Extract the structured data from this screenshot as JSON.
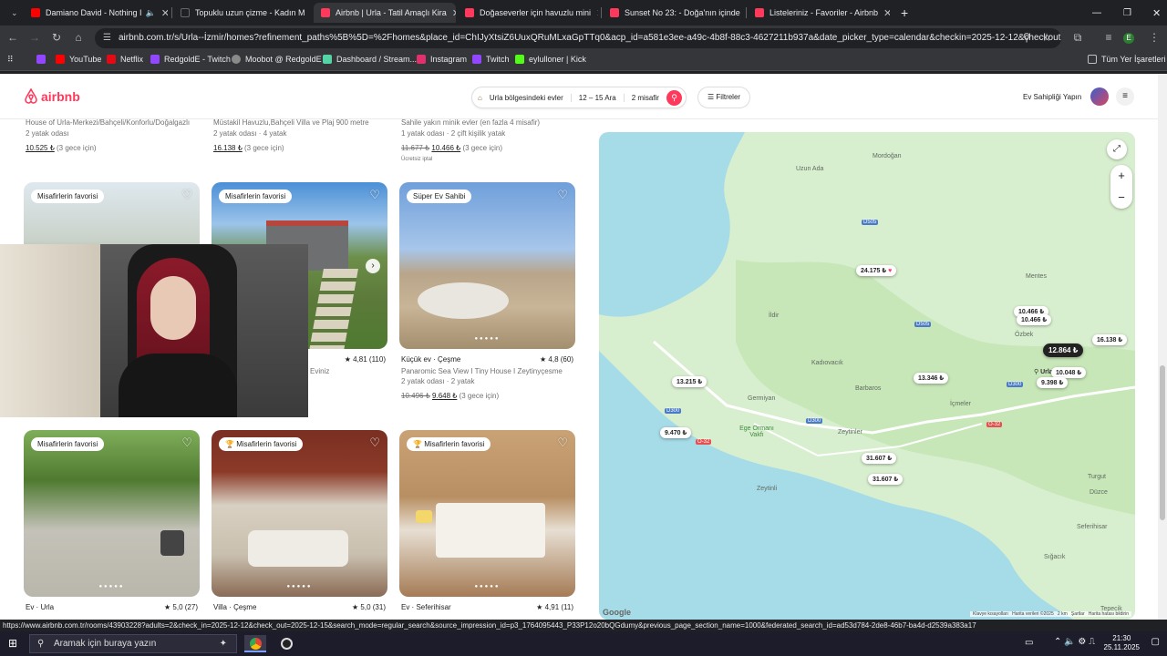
{
  "browser": {
    "tabs": [
      {
        "label": "Damiano David - Nothing I",
        "color": "#ff0000"
      },
      {
        "label": "Topuklu uzun çizme - Kadın M",
        "color": "#202124"
      },
      {
        "label": "Airbnb | Urla - Tatil Amaçlı Kira",
        "color": "#ff385c"
      },
      {
        "label": "Doğaseverler için havuzlu mini",
        "color": "#ff385c"
      },
      {
        "label": "Sunset No 23: - Doğa'nın içinde",
        "color": "#ff385c"
      },
      {
        "label": "Listeleriniz - Favoriler - Airbnb",
        "color": "#ff385c"
      }
    ],
    "url": "airbnb.com.tr/s/Urla--İzmir/homes?refinement_paths%5B%5D=%2Fhomes&place_id=ChIJyXtsiZ6UuxQRuMLxaGpTTq0&acp_id=a581e3ee-a49c-4b8f-88c3-4627211b937a&date_picker_type=calendar&checkin=2025-12-12&checkout=202...",
    "bookmarks": [
      "YouTube",
      "Netflix",
      "RedgoldE - Twitch",
      "Moobot @ RedgoldE",
      "Dashboard / Stream...",
      "Instagram",
      "Twitch",
      "eylulloner | Kick"
    ],
    "all_bookmarks": "Tüm Yer İşaretleri"
  },
  "header": {
    "logo": "airbnb",
    "location": "Urla bölgesindeki evler",
    "dates": "12 – 15 Ara",
    "guests": "2 misafir",
    "filters": "Filtreler",
    "host": "Ev Sahipliği Yapın"
  },
  "top_row": [
    {
      "title": "House of Urla-Merkezi/Bahçeli/Konforlu/Doğalgazlı",
      "sub": "2 yatak odası",
      "price": "10.525 ₺",
      "nights": "(3 gece için)",
      "old": ""
    },
    {
      "title": "Müstakil Havuzlu,Bahçeli Villa ve Plaj 900 metre",
      "sub": "2 yatak odası · 4 yatak",
      "price": "16.138 ₺",
      "nights": "(3 gece için)",
      "old": ""
    },
    {
      "title": "Sahile yakın minik evler (en fazla 4 misafir)",
      "sub": "1 yatak odası · 2 çift kişilik yatak",
      "price": "10.466 ₺",
      "nights": "(3 gece için)",
      "old": "11.677 ₺",
      "extra": "Ücretsiz iptal"
    }
  ],
  "cards": [
    {
      "badge": "Misafirlerin favorisi",
      "title": "",
      "rating": "",
      "sub1": "",
      "sub2": "",
      "price": "",
      "old": ""
    },
    {
      "badge": "Misafirlerin favorisi",
      "title": "",
      "rating": "★ 4,81 (110)",
      "sub1": "Eviniz",
      "sub2": "",
      "price": "",
      "old": ""
    },
    {
      "badge": "Süper Ev Sahibi",
      "title": "Küçük ev · Çeşme",
      "rating": "★ 4,8 (60)",
      "sub1": "Panaromic Sea View I Tiny House I Zeytinyçesme",
      "sub2": "2 yatak odası · 2 yatak",
      "price": "9.648 ₺",
      "old": "10.496 ₺",
      "nights": "(3 gece için)"
    },
    {
      "badge": "Misafirlerin favorisi",
      "title": "Ev · Urla",
      "rating": "★ 5,0 (27)",
      "sub1": "",
      "sub2": "",
      "price": "",
      "old": ""
    },
    {
      "badge": "Misafirlerin favorisi",
      "title": "Villa · Çeşme",
      "rating": "★ 5,0 (31)",
      "sub1": "",
      "sub2": "",
      "price": "",
      "old": ""
    },
    {
      "badge": "Misafirlerin favorisi",
      "title": "Ev · Seferihisar",
      "rating": "★ 4,91 (11)",
      "sub1": "",
      "sub2": "",
      "price": "",
      "old": ""
    }
  ],
  "map": {
    "pins": [
      "24.175 ₺",
      "10.466 ₺",
      "10.466 ₺",
      "16.138 ₺",
      "12.864 ₺",
      "9.398 ₺",
      "13.346 ₺",
      "13.215 ₺",
      "9.470 ₺",
      "31.607 ₺",
      "31.607 ₺",
      "10.048 ₺"
    ],
    "places": [
      "Mordoğan",
      "Uzun Ada",
      "Mentes",
      "İldir",
      "Özbek",
      "Kadıovacık",
      "Germiyan",
      "Barbaros",
      "İçmeler",
      "Ege Ormanı Vakfı",
      "Zeytinler",
      "Zeytinli",
      "Turgut",
      "Düzce",
      "Seferihisar",
      "Sığacık",
      "Tepecik",
      "Urla"
    ],
    "roads": [
      "D505",
      "D505",
      "D300",
      "D300",
      "O-32",
      "O-32",
      "D300"
    ],
    "footer": "Klavye kısayolları   Harita verileri ©2025   2 km   Şartlar   Harita hatası bildirin",
    "google": "Google"
  },
  "status_url": "https://www.airbnb.com.tr/rooms/43903228?adults=2&check_in=2025-12-12&check_out=2025-12-15&search_mode=regular_search&source_impression_id=p3_1764095443_P33P12o20bQGdumy&previous_page_section_name=1000&federated_search_id=ad53d784-2de8-46b7-ba4d-d2539a383a17",
  "taskbar": {
    "search": "Aramak için buraya yazın",
    "time": "21:30",
    "date": "25.11.2025"
  }
}
